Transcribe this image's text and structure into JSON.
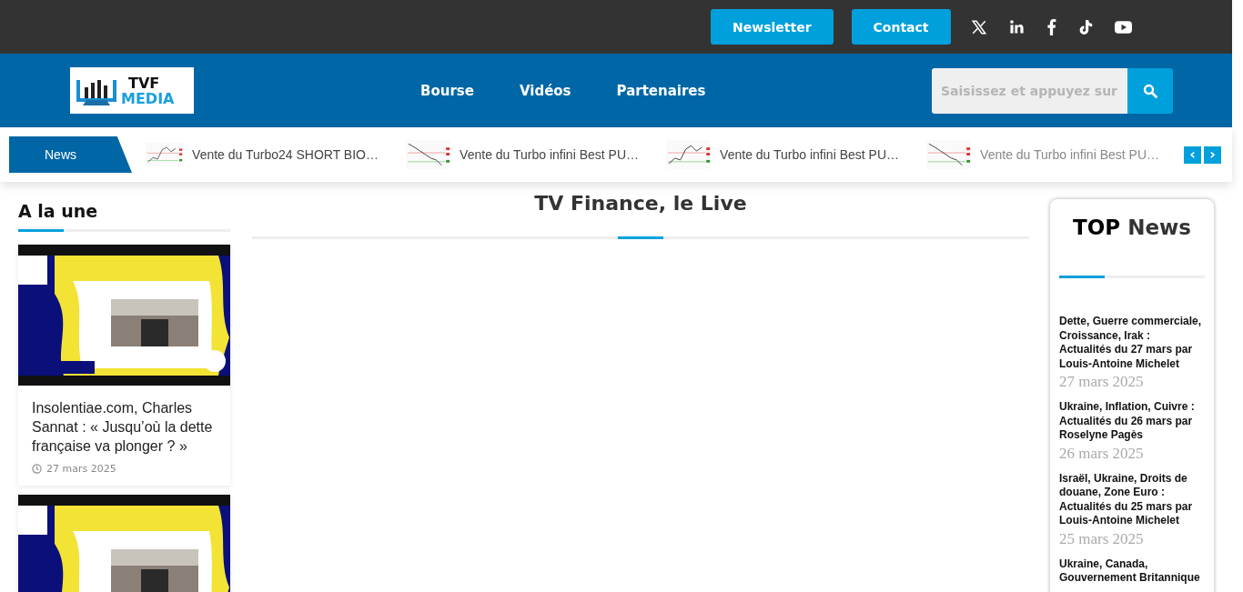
{
  "top_bar": {
    "buttons": [
      "Newsletter",
      "Contact"
    ]
  },
  "header": {
    "logo": {
      "line1": "TVF",
      "line2": "MEDIA"
    },
    "nav": [
      "Bourse",
      "Vidéos",
      "Partenaires"
    ],
    "search": {
      "placeholder": "Saisissez et appuyez sur"
    }
  },
  "ticker": {
    "label": "News",
    "items": [
      {
        "title": "Vente du Turbo24 SHORT BIO…",
        "faded": false
      },
      {
        "title": "Vente du Turbo infini Best PU…",
        "faded": false
      },
      {
        "title": "Vente du Turbo infini Best PU…",
        "faded": false
      },
      {
        "title": "Vente du Turbo infini Best PU…",
        "faded": true
      }
    ],
    "prev": "‹",
    "next": "›"
  },
  "a_la_une": {
    "title": "A la une",
    "articles": [
      {
        "kind": "picture",
        "title": "Insolentiae.com, Charles Sannat : « Jusqu’où la dette française va plonger ? »",
        "date": "27 mars 2025"
      },
      {
        "kind": "picture"
      }
    ]
  },
  "main": {
    "title": "TV Finance, le Live"
  },
  "top_news": {
    "title_bold": "TOP",
    "title_rest": "News",
    "items": [
      {
        "title": "Dette, Guerre commerciale, Croissance, Irak : Actualités du 27 mars par Louis-Antoine Michelet",
        "date": "27 mars 2025"
      },
      {
        "title": "Ukraine, Inflation, Cuivre : Actualités du 26 mars par Roselyne Pagès",
        "date": "26 mars 2025"
      },
      {
        "title": "Israël, Ukraine, Droits de douane, Zone Euro : Actualités du 25 mars par Louis-Antoine Michelet",
        "date": "25 mars 2025"
      },
      {
        "title": "Ukraine, Canada, Gouvernement Britannique"
      }
    ]
  }
}
